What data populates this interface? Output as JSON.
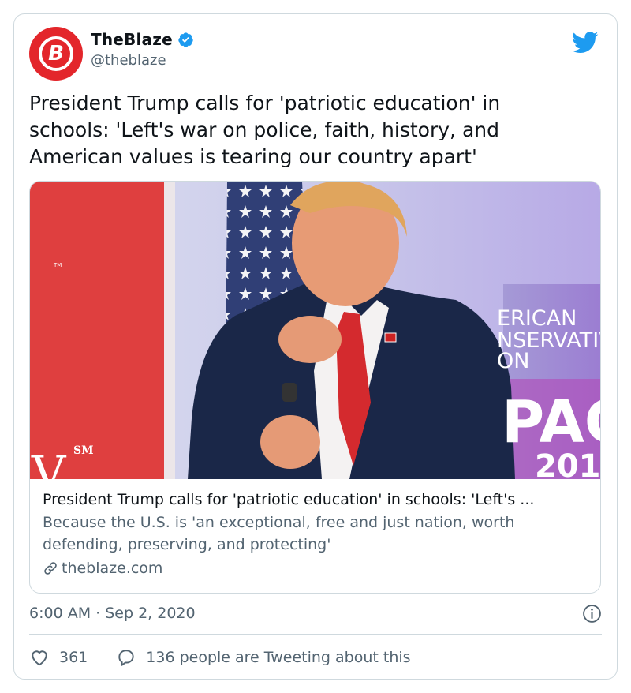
{
  "account": {
    "display_name": "TheBlaze",
    "handle": "@theblaze",
    "avatar_letter": "B",
    "verified": true
  },
  "tweet": {
    "text": "President Trump calls for 'patriotic education' in\nschools: 'Left's war on police, faith, history, and\nAmerican values is tearing our country apart'",
    "timestamp": "6:00 AM · Sep 2, 2020"
  },
  "link_card": {
    "title": "President Trump calls for 'patriotic education' in schools: 'Left's ...",
    "description": "Because the U.S. is 'an exceptional, free and just nation, worth defending, preserving, and protecting'",
    "domain": "theblaze.com",
    "image_text": {
      "left_sm": "SM",
      "left_tm": "TM",
      "left_v": "V",
      "banner_line1": "ERICAN",
      "banner_line2": "NSERVATIV",
      "banner_line3": "ON",
      "banner_pac": "PAC",
      "banner_year": "201"
    }
  },
  "actions": {
    "likes": "361",
    "tweeting": "136 people are Tweeting about this"
  },
  "colors": {
    "brand_red": "#e3262b",
    "twitter_blue": "#1d9bf0",
    "text_primary": "#0f1419",
    "text_secondary": "#536471",
    "border": "#cfd9de"
  },
  "icons": [
    "verified-badge-icon",
    "twitter-bird-icon",
    "link-icon",
    "info-icon",
    "heart-icon",
    "reply-bubble-icon"
  ]
}
